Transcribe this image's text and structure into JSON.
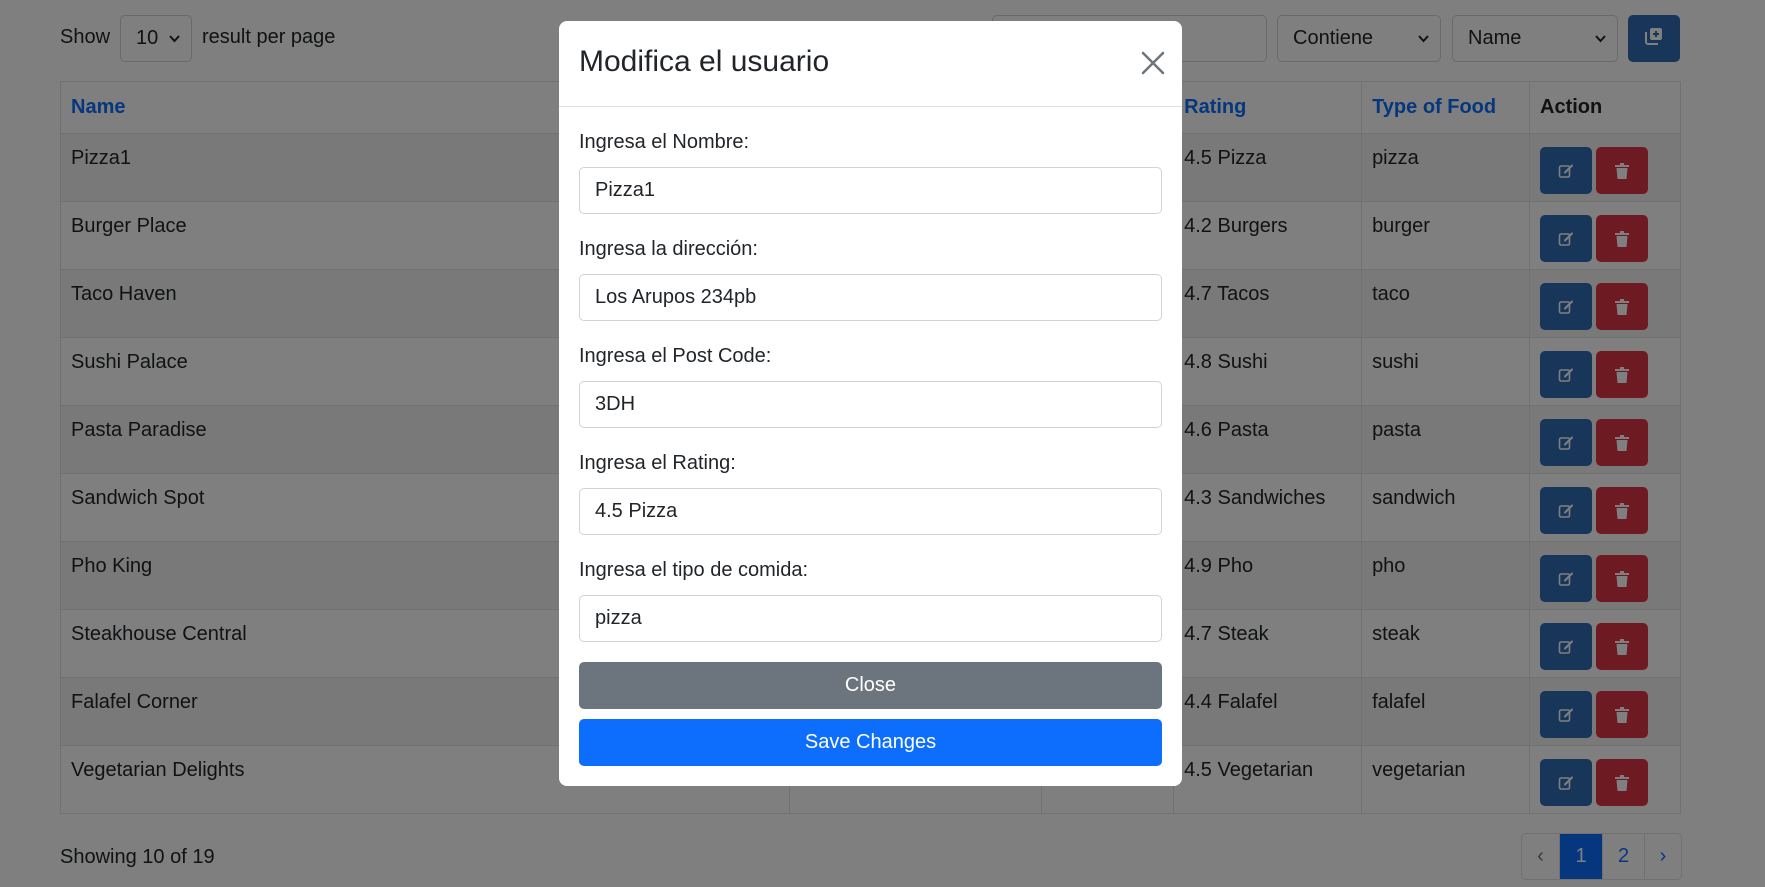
{
  "toolbar": {
    "show_label": "Show",
    "per_page_value": "10",
    "per_page_label": "result per page",
    "filter_mode": "Contiene",
    "filter_field": "Name"
  },
  "table": {
    "headers": [
      "Name",
      "Rating",
      "Type of Food",
      "Action"
    ],
    "rows": [
      {
        "name": "Pizza1",
        "rating": "4.5 Pizza",
        "food": "pizza"
      },
      {
        "name": "Burger Place",
        "rating": "4.2 Burgers",
        "food": "burger"
      },
      {
        "name": "Taco Haven",
        "rating": "4.7 Tacos",
        "food": "taco"
      },
      {
        "name": "Sushi Palace",
        "rating": "4.8 Sushi",
        "food": "sushi"
      },
      {
        "name": "Pasta Paradise",
        "rating": "4.6 Pasta",
        "food": "pasta"
      },
      {
        "name": "Sandwich Spot",
        "rating": "4.3 Sandwiches",
        "food": "sandwich"
      },
      {
        "name": "Pho King",
        "rating": "4.9 Pho",
        "food": "pho"
      },
      {
        "name": "Steakhouse Central",
        "rating": "4.7 Steak",
        "food": "steak"
      },
      {
        "name": "Falafel Corner",
        "rating": "4.4 Falafel",
        "food": "falafel"
      },
      {
        "name": "Vegetarian Delights",
        "rating": "4.5 Vegetarian",
        "food": "vegetarian"
      }
    ]
  },
  "footer": {
    "showing": "Showing 10 of 19",
    "prev": "‹",
    "pages": [
      "1",
      "2"
    ],
    "next": "›"
  },
  "modal": {
    "title": "Modifica el usuario",
    "fields": [
      {
        "label": "Ingresa el Nombre:",
        "value": "Pizza1"
      },
      {
        "label": "Ingresa la dirección:",
        "value": "Los Arupos 234pb"
      },
      {
        "label": "Ingresa el Post Code:",
        "value": "3DH"
      },
      {
        "label": "Ingresa el Rating:",
        "value": "4.5 Pizza"
      },
      {
        "label": "Ingresa el tipo de comida:",
        "value": "pizza"
      }
    ],
    "close_label": "Close",
    "save_label": "Save Changes"
  },
  "icons": {
    "add": "add-copy-icon",
    "edit": "edit-icon",
    "delete": "trash-icon",
    "close": "close-icon"
  },
  "colors": {
    "primary": "#0d6efd",
    "edit_button": "#2f6db5",
    "delete_button": "#dc3545",
    "secondary": "#6c757d"
  }
}
